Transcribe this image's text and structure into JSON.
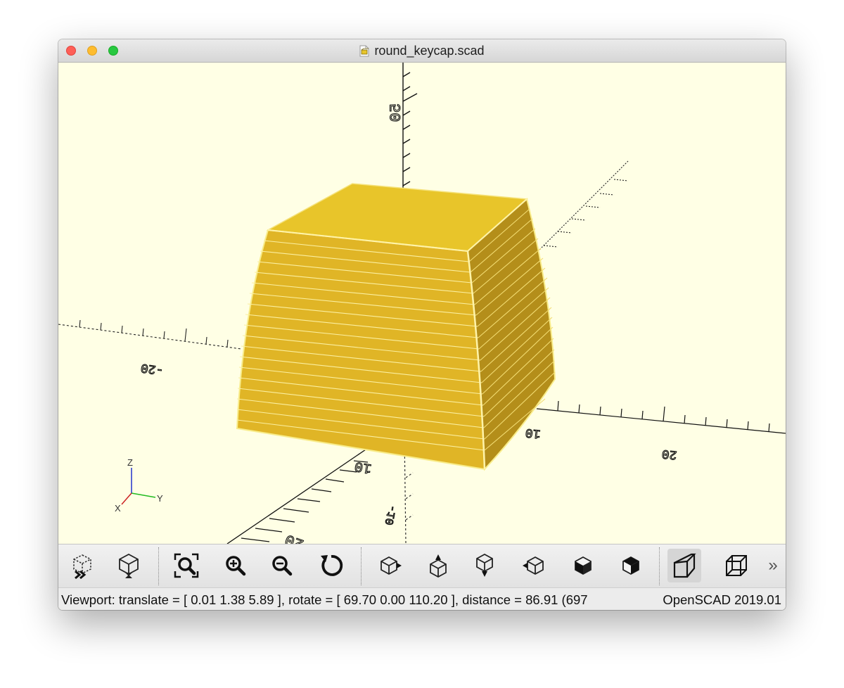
{
  "window": {
    "title": "round_keycap.scad",
    "traffic_lights": {
      "close": {
        "name": "close-button",
        "color": "#fe5f57"
      },
      "minimize": {
        "name": "minimize-button",
        "color": "#febc2e"
      },
      "zoom": {
        "name": "zoom-button",
        "color": "#28c840"
      }
    }
  },
  "viewport": {
    "background": "#ffffe5",
    "model_color": "#e8c52a",
    "axis_labels": {
      "z_top": "50",
      "x_neg": "-20",
      "y_pos_near": "10",
      "y_pos_far": "20",
      "x_pos_near": "10",
      "x_pos_far": "20",
      "z_neg": "-10"
    },
    "orientation_gizmo": {
      "z": "Z",
      "y": "Y",
      "x": "X"
    }
  },
  "toolbar": {
    "buttons": [
      {
        "id": "preview",
        "icon": "preview-icon"
      },
      {
        "id": "render",
        "icon": "render-icon"
      },
      {
        "id": "view-all",
        "icon": "view-all-icon"
      },
      {
        "id": "zoom-in",
        "icon": "zoom-in-icon"
      },
      {
        "id": "zoom-out",
        "icon": "zoom-out-icon"
      },
      {
        "id": "reset-view",
        "icon": "reset-view-icon"
      },
      {
        "id": "view-right",
        "icon": "view-right-icon"
      },
      {
        "id": "view-top",
        "icon": "view-top-icon"
      },
      {
        "id": "view-bottom",
        "icon": "view-bottom-icon"
      },
      {
        "id": "view-left",
        "icon": "view-left-icon"
      },
      {
        "id": "view-front",
        "icon": "view-front-icon"
      },
      {
        "id": "view-back",
        "icon": "view-back-icon"
      },
      {
        "id": "perspective",
        "icon": "perspective-icon",
        "active": true
      },
      {
        "id": "orthogonal",
        "icon": "orthogonal-icon"
      }
    ],
    "overflow_label": "»"
  },
  "status": {
    "viewport_text": "Viewport: translate = [ 0.01 1.38 5.89 ], rotate = [ 69.70 0.00 110.20 ], distance = 86.91 (697",
    "version_text": "OpenSCAD 2019.01"
  }
}
